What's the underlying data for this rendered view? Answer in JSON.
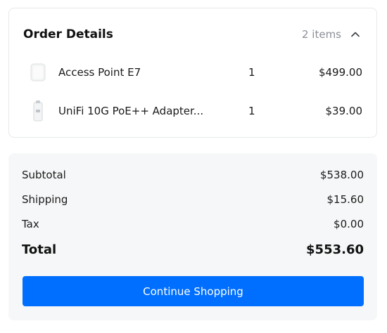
{
  "order": {
    "title": "Order Details",
    "items_count": "2 items",
    "toggle_icon": "chevron-up-icon",
    "items": [
      {
        "name": "Access Point E7",
        "qty": "1",
        "price": "$499.00",
        "thumb_icon": "access-point-thumbnail"
      },
      {
        "name": "UniFi 10G PoE++ Adapter...",
        "qty": "1",
        "price": "$39.00",
        "thumb_icon": "poe-adapter-thumbnail"
      }
    ]
  },
  "summary": {
    "subtotal_label": "Subtotal",
    "subtotal_value": "$538.00",
    "shipping_label": "Shipping",
    "shipping_value": "$15.60",
    "tax_label": "Tax",
    "tax_value": "$0.00",
    "total_label": "Total",
    "total_value": "$553.60"
  },
  "actions": {
    "continue_label": "Continue Shopping"
  },
  "colors": {
    "primary_button": "#006fff",
    "summary_background": "#f6f7f8",
    "muted_text": "#8a8f95"
  }
}
